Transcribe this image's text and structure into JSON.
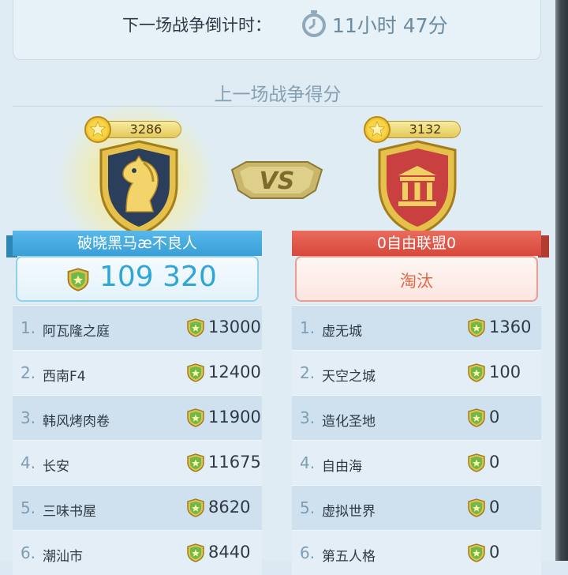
{
  "countdown": {
    "label": "下一场战争倒计时：",
    "value": "11小时 47分"
  },
  "section_title": "上一场战争得分",
  "vs_label": "VS",
  "left": {
    "alliance_score": "3286",
    "name": "破晓黑马æ不良人",
    "total": "109 320",
    "emblem": "knight-horse-icon",
    "color": "#3ea7df",
    "rows": [
      {
        "rank": "1.",
        "name": "阿瓦隆之庭",
        "points": "13000"
      },
      {
        "rank": "2.",
        "name": "西南F4",
        "points": "12400"
      },
      {
        "rank": "3.",
        "name": "韩风烤肉卷",
        "points": "11900"
      },
      {
        "rank": "4.",
        "name": "长安",
        "points": "11675"
      },
      {
        "rank": "5.",
        "name": "三味书屋",
        "points": "8620"
      },
      {
        "rank": "6.",
        "name": "潮汕市",
        "points": "8440"
      }
    ]
  },
  "right": {
    "alliance_score": "3132",
    "name": "0自由联盟0",
    "status": "淘汰",
    "emblem": "temple-icon",
    "color": "#e0584b",
    "rows": [
      {
        "rank": "1.",
        "name": "虚无城",
        "points": "1360"
      },
      {
        "rank": "2.",
        "name": "天空之城",
        "points": "100"
      },
      {
        "rank": "3.",
        "name": "造化圣地",
        "points": "0"
      },
      {
        "rank": "4.",
        "name": "自由海",
        "points": "0"
      },
      {
        "rank": "5.",
        "name": "虚拟世界",
        "points": "0"
      },
      {
        "rank": "6.",
        "name": "第五人格",
        "points": "0"
      }
    ]
  }
}
